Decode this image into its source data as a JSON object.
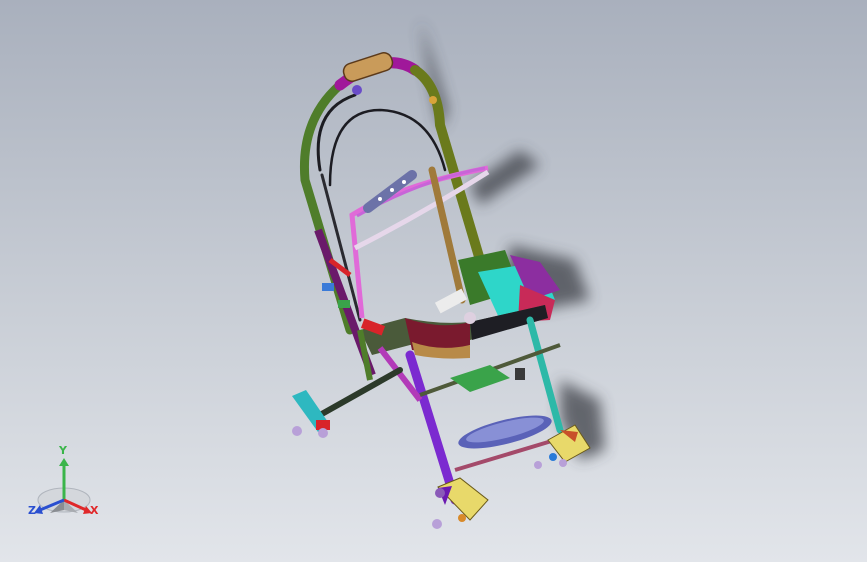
{
  "viewport": {
    "background_top": "#a9b0bd",
    "background_bottom": "#e2e5ea"
  },
  "model": {
    "kind": "3D assembly of folding stroller (CAD view)",
    "colors": {
      "handle_purple": "#a0189a",
      "handle_olive": "#6a7a1c",
      "frame_pink": "#e06ad8",
      "frame_green": "#4f7d2a",
      "seat_dark_red": "#7a1a2e",
      "tray_cyan": "#2ed6c9",
      "leg_violet": "#7b2ad0",
      "leg_cyan": "#2db9a8",
      "footrest_blue": "#5a62b8",
      "wheel_block_yellow": "#e8d96a",
      "accent_red": "#d8242a",
      "platform_green": "#3aa34a",
      "shadow": "#3c3f46"
    }
  },
  "triad": {
    "y_label": "Y",
    "x_label": "X",
    "z_label": "Z",
    "y_color": "#3ab54a",
    "x_color": "#e0282a",
    "z_color": "#2a4fd0"
  }
}
